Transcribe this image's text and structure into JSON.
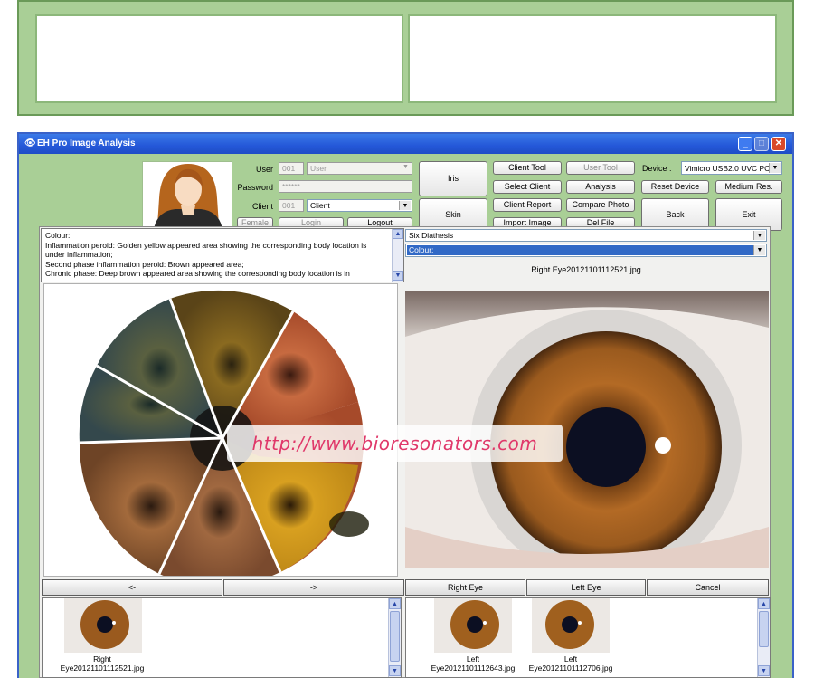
{
  "window": {
    "title": "EH Pro Image Analysis"
  },
  "login": {
    "user_label": "User",
    "user_id": "001",
    "user_name": "User",
    "password_label": "Password",
    "password_value": "******",
    "client_label": "Client",
    "client_id": "001",
    "client_name": "Client",
    "gender": "Female",
    "login_label": "Login",
    "logout_label": "Logout"
  },
  "mode_buttons": {
    "iris": "Iris",
    "skin": "Skin"
  },
  "tools": {
    "client_tool": "Client Tool",
    "user_tool": "User Tool",
    "select_client": "Select Client",
    "analysis": "Analysis",
    "client_report": "Client Report",
    "compare_photo": "Compare Photo",
    "import_image": "Import Image",
    "del_file": "Del File"
  },
  "device": {
    "label": "Device :",
    "value": "Vimicro USB2.0 UVC PC",
    "reset_device": "Reset Device",
    "medium_res": "Medium Res.",
    "back": "Back",
    "exit": "Exit"
  },
  "description": {
    "lines": [
      "Colour:",
      "Inflammation peroid: Golden yellow appeared area showing the corresponding body location is",
      "under inflammation;",
      "Second phase inflammation peroid: Brown appeared area;",
      "Chronic phase: Deep brown appeared area showing the corresponding body location is in"
    ]
  },
  "analysis_select": {
    "diathesis": "Six Diathesis",
    "category": "Colour:"
  },
  "right_image": {
    "filename": "Right Eye20121101112521.jpg"
  },
  "watermark": "http://www.bioresonators.com",
  "nav": {
    "prev": "<-",
    "next": "->",
    "right_eye": "Right Eye",
    "left_eye": "Left Eye",
    "cancel": "Cancel"
  },
  "thumbnails_left": [
    {
      "line1": "Right",
      "line2": "Eye20121101112521.jpg"
    }
  ],
  "thumbnails_right": [
    {
      "line1": "Left",
      "line2": "Eye20121101112643.jpg"
    },
    {
      "line1": "Left",
      "line2": "Eye20121101112706.jpg"
    }
  ],
  "colors": {
    "frame_green": "#a9cf96",
    "title_blue": "#2457d8",
    "select_blue": "#3169c6",
    "iris_brown": "#b36a25"
  }
}
